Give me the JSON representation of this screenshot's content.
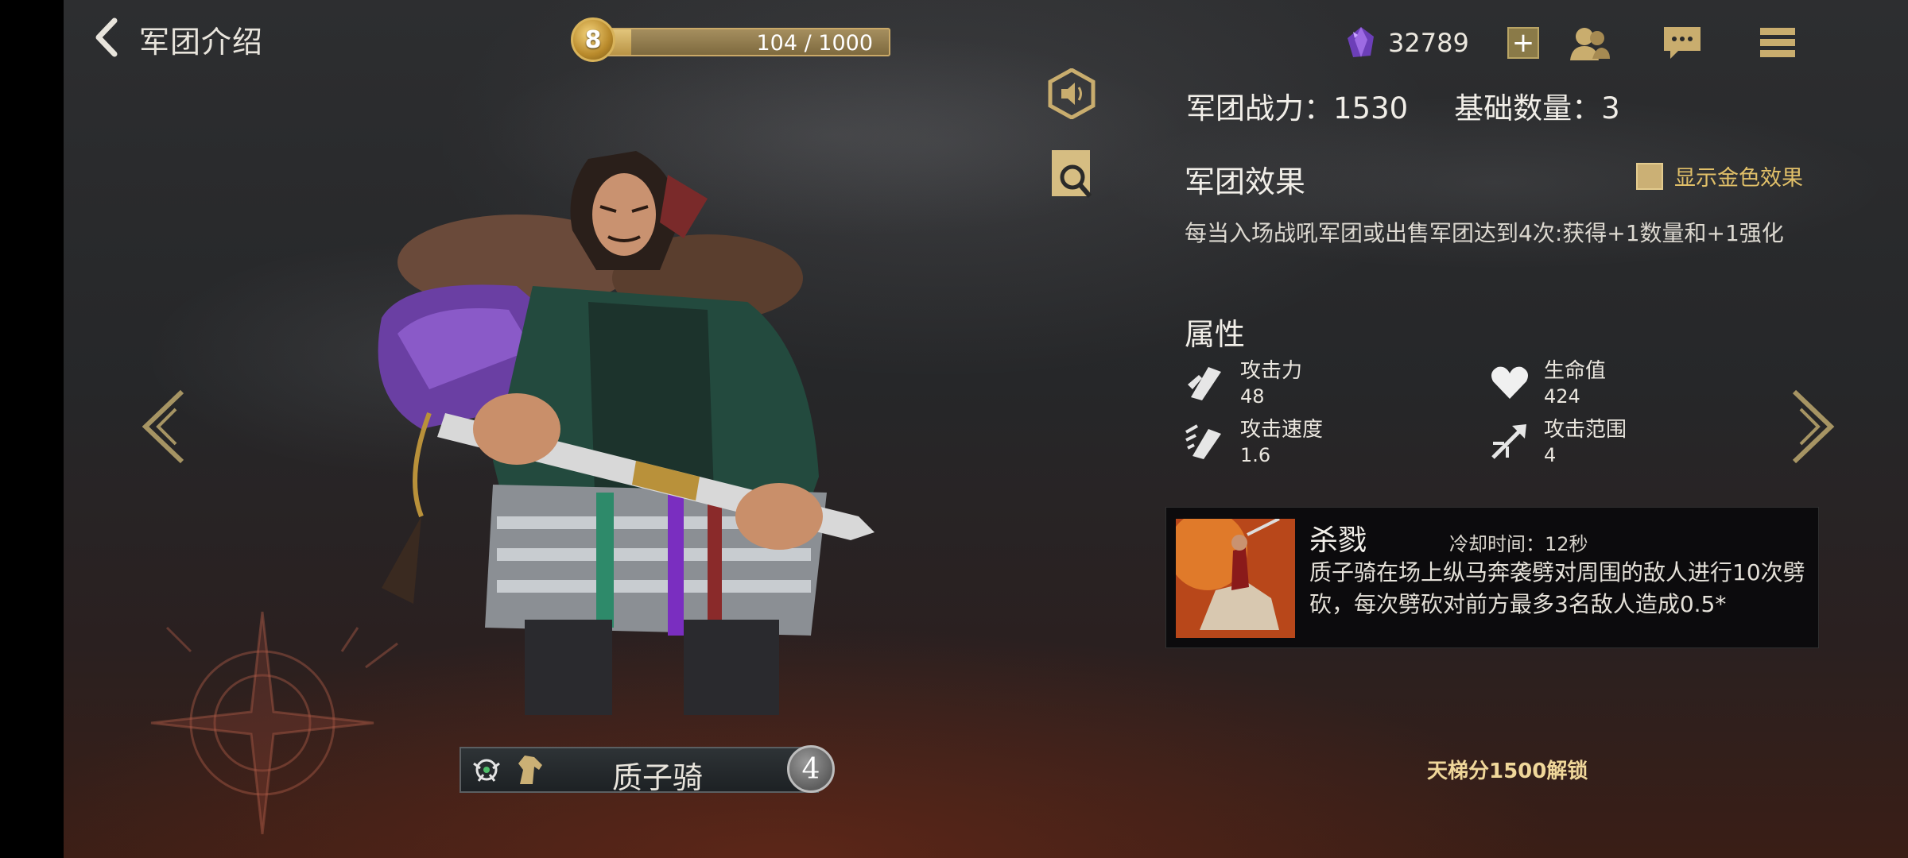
{
  "header": {
    "title": "军团介绍",
    "level": "8",
    "xp_text": "104 / 1000",
    "xp_fraction": 0.104
  },
  "currency": {
    "value": "32789",
    "add_label": "+"
  },
  "icons": {
    "back": "chevron-left-icon",
    "gem": "purple-gem-icon",
    "friends": "friends-icon",
    "chat": "chat-bubble-icon",
    "menu": "menu-list-icon",
    "sound": "speaker-icon",
    "inspect": "magnifier-icon",
    "prev": "arrow-left-icon",
    "next": "arrow-right-icon"
  },
  "unit": {
    "name": "质子骑",
    "level": "4"
  },
  "stats": {
    "power": "军团战力：1530",
    "base_count": "基础数量：3"
  },
  "effect": {
    "title": "军团效果",
    "toggle_label": "显示金色效果",
    "description": "每当入场战吼军团或出售军团达到4次:获得+1数量和+1强化"
  },
  "attributes": {
    "title": "属性",
    "items": [
      {
        "name": "攻击力",
        "value": "48"
      },
      {
        "name": "生命值",
        "value": "424"
      },
      {
        "name": "攻击速度",
        "value": "1.6"
      },
      {
        "name": "攻击范围",
        "value": "4"
      }
    ]
  },
  "skill": {
    "name": "杀戮",
    "cooldown": "冷却时间：12秒",
    "description": "质子骑在场上纵马奔袭劈对周围的敌人进行10次劈砍，每次劈砍对前方最多3名敌人造成0.5*"
  },
  "unlock": "天梯分1500解锁",
  "colors": {
    "gold": "#e1c069",
    "accent": "#cbb075",
    "panel": "#08080a"
  }
}
